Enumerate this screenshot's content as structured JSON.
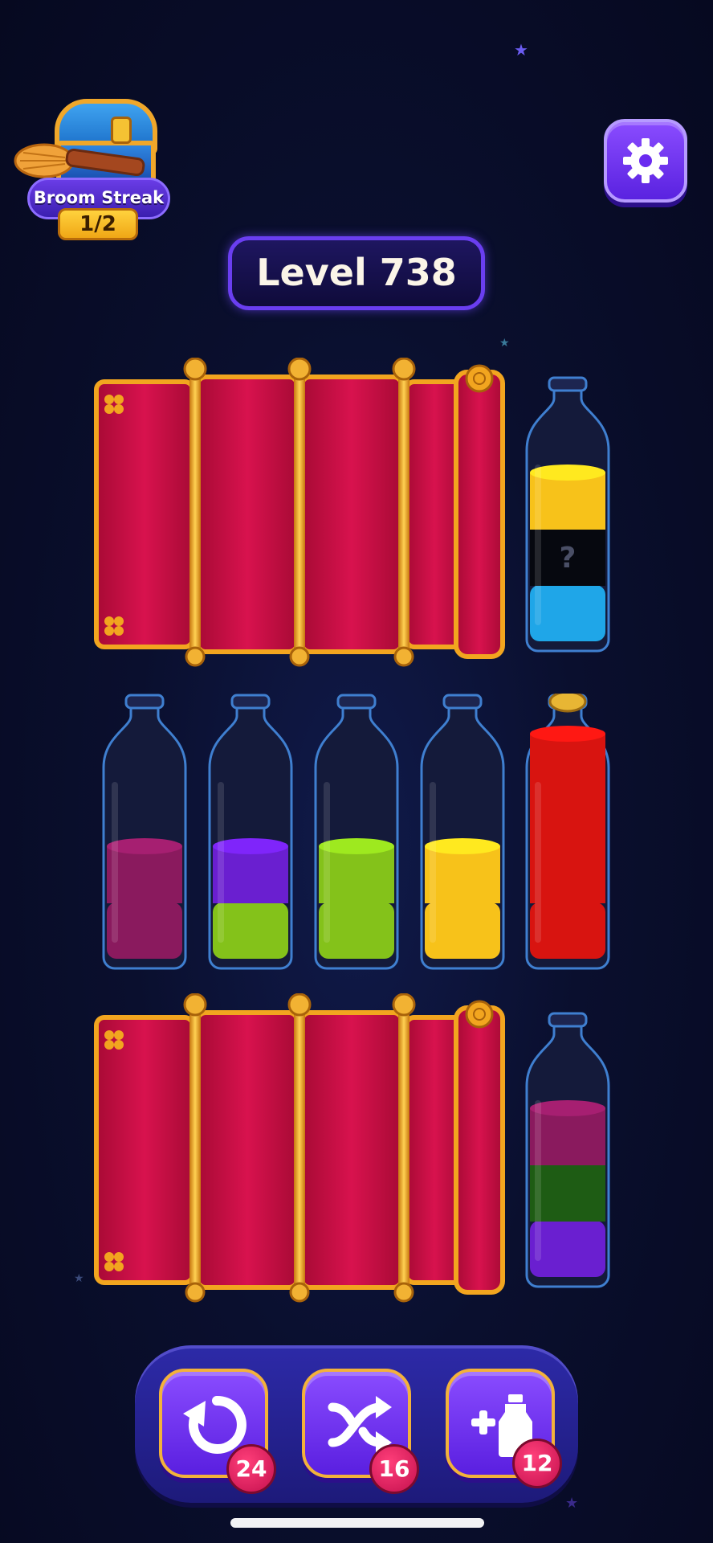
{
  "streak": {
    "title": "Broom Streak",
    "progress_text": "1/2"
  },
  "level": {
    "label": "Level 738"
  },
  "colors": {
    "yellow": "#f7c21a",
    "cyan": "#1fa6e8",
    "magenta": "#8a1a5e",
    "purple": "#6a1fd0",
    "lime": "#84c21a",
    "red": "#d81410",
    "dark_green": "#1e5c14",
    "unknown": "#06080f",
    "curtain": "#c80f45",
    "gold": "#f2a51f"
  },
  "bottles": {
    "top_right": {
      "hidden_marker": "?",
      "layers": [
        "cyan",
        "unknown",
        "yellow"
      ]
    },
    "middle_1": {
      "layers": [
        "magenta",
        "magenta"
      ]
    },
    "middle_2": {
      "layers": [
        "lime",
        "purple"
      ]
    },
    "middle_3": {
      "layers": [
        "lime",
        "lime"
      ]
    },
    "middle_4": {
      "layers": [
        "yellow",
        "yellow"
      ]
    },
    "middle_5": {
      "corked": true,
      "layers": [
        "red",
        "red",
        "red",
        "red"
      ]
    },
    "bottom_right": {
      "layers": [
        "purple",
        "dark_green",
        "magenta"
      ]
    }
  },
  "toolbar": {
    "undo": {
      "icon": "undo-icon",
      "count": "24"
    },
    "shuffle": {
      "icon": "shuffle-icon",
      "count": "16"
    },
    "add_bottle": {
      "icon": "add-bottle-icon",
      "count": "12"
    }
  }
}
